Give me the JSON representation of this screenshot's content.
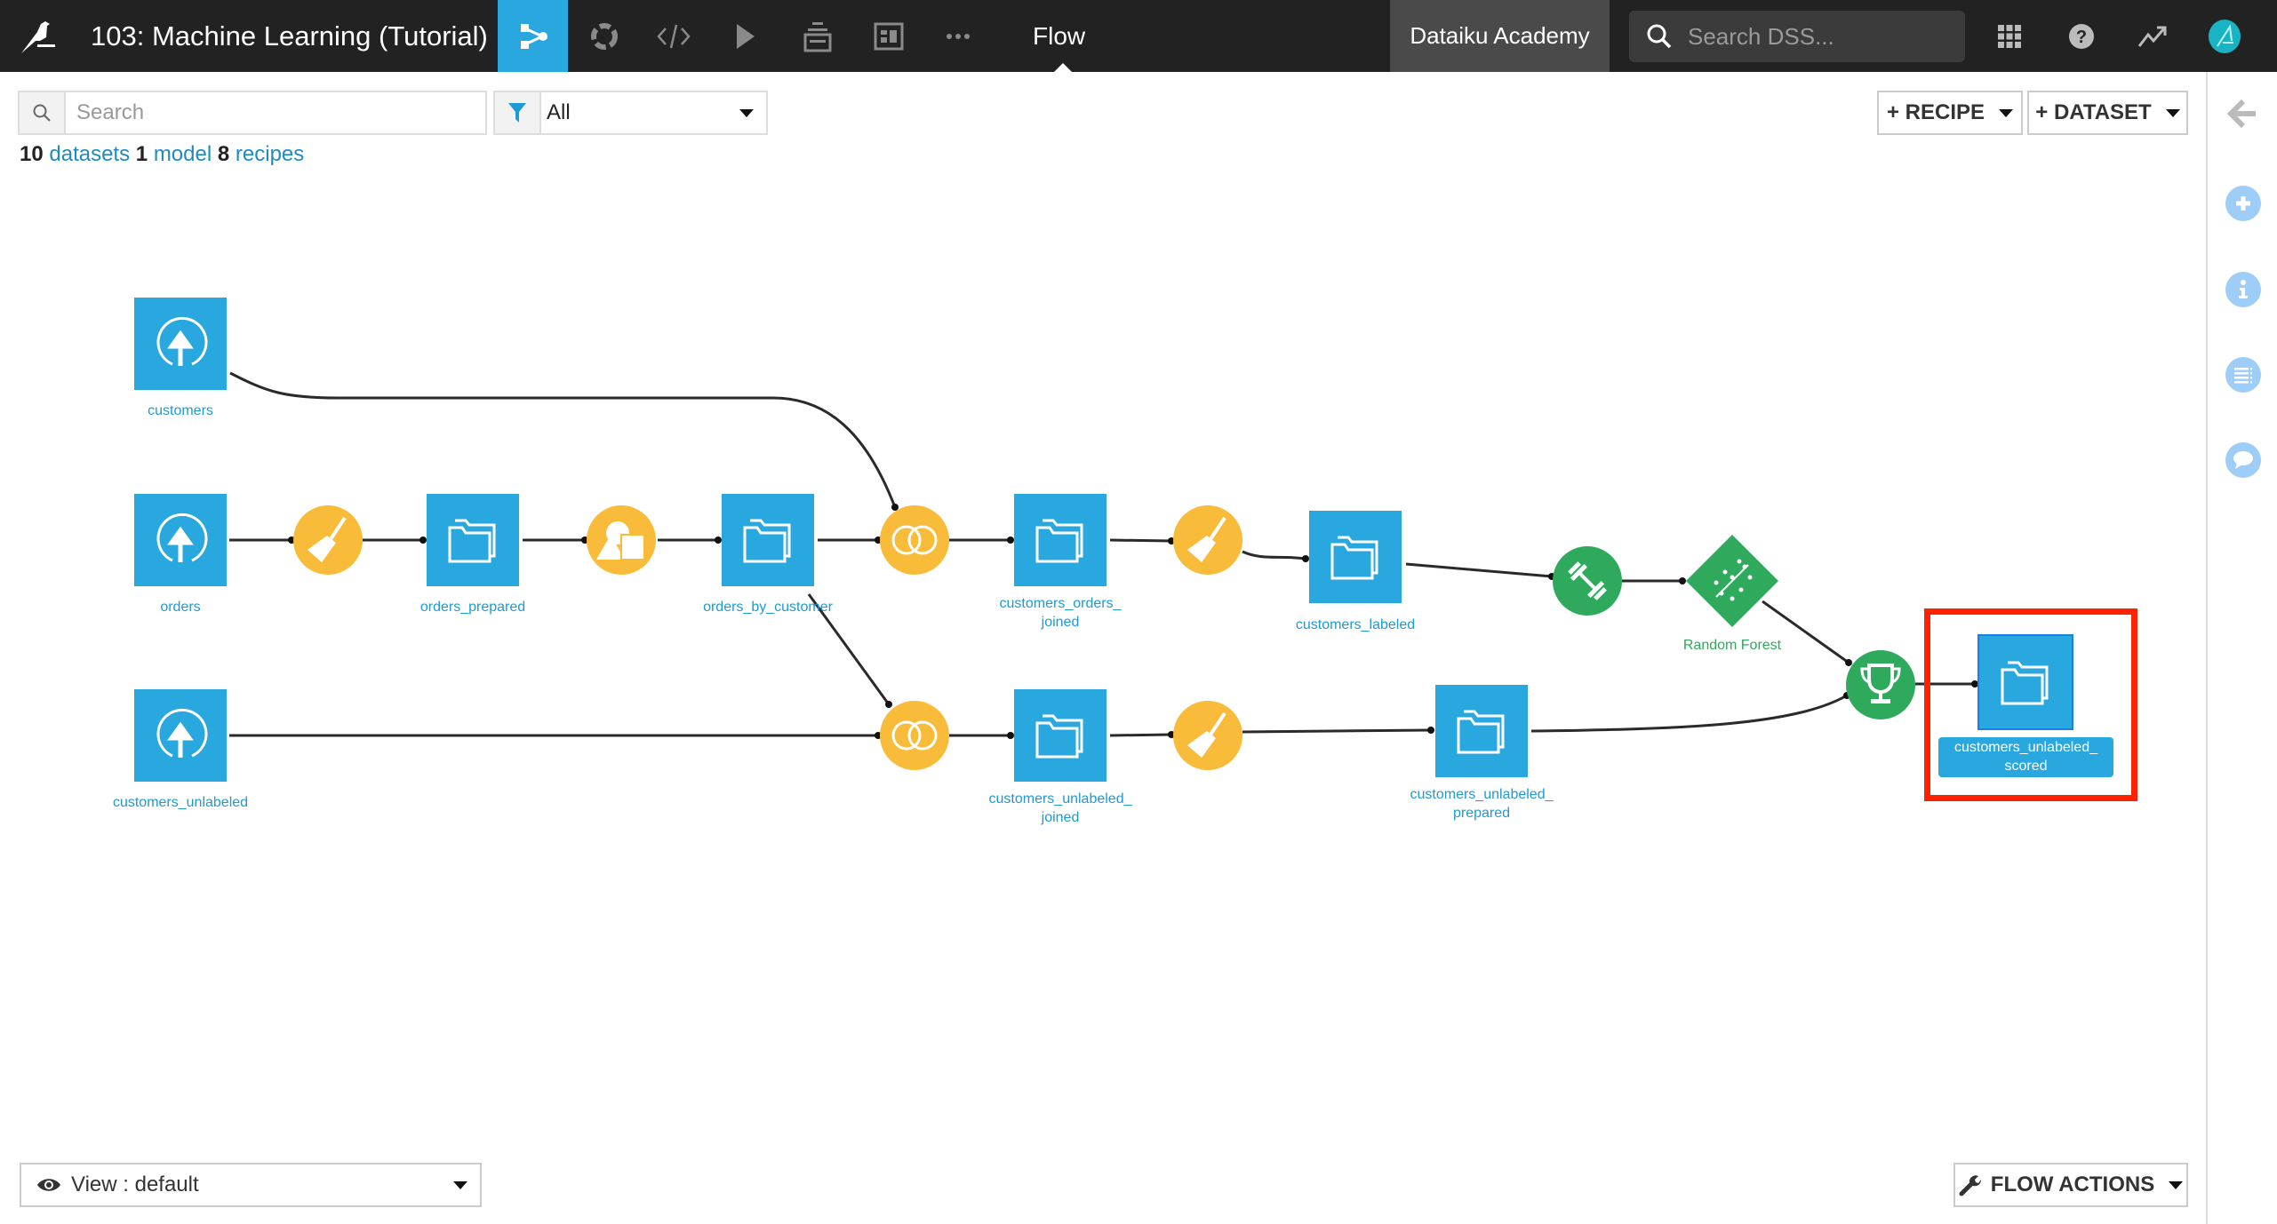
{
  "topbar": {
    "project_title": "103: Machine Learning (Tutorial)",
    "nav_icons": [
      "flow-icon",
      "recipes-circle-icon",
      "code-icon",
      "play-icon",
      "stack-icon",
      "dashboard-icon",
      "more-icon"
    ],
    "current_section": "Flow",
    "instance_name": "Dataiku Academy",
    "search_placeholder": "Search DSS..."
  },
  "toolbar": {
    "search_placeholder": "Search",
    "filter_value": "All",
    "counts": {
      "datasets_count": "10",
      "datasets_label": "datasets",
      "models_count": "1",
      "models_label": "model",
      "recipes_count": "8",
      "recipes_label": "recipes"
    },
    "recipe_button": "+ RECIPE",
    "dataset_button": "+ DATASET"
  },
  "flow": {
    "datasets": [
      {
        "id": "customers",
        "label": "customers",
        "kind": "uploaded"
      },
      {
        "id": "orders",
        "label": "orders",
        "kind": "uploaded"
      },
      {
        "id": "customers_unlabeled",
        "label": "customers_unlabeled",
        "kind": "uploaded"
      },
      {
        "id": "orders_prepared",
        "label": "orders_prepared",
        "kind": "managed"
      },
      {
        "id": "orders_by_customer",
        "label": "orders_by_customer",
        "kind": "managed"
      },
      {
        "id": "customers_orders_joined",
        "label_line1": "customers_orders_",
        "label_line2": "joined",
        "kind": "managed"
      },
      {
        "id": "customers_unlabeled_joined",
        "label_line1": "customers_unlabeled_",
        "label_line2": "joined",
        "kind": "managed"
      },
      {
        "id": "customers_labeled",
        "label": "customers_labeled",
        "kind": "managed"
      },
      {
        "id": "customers_unlabeled_prepared",
        "label_line1": "customers_unlabeled_",
        "label_line2": "prepared",
        "kind": "managed"
      },
      {
        "id": "customers_unlabeled_scored",
        "label_line1": "customers_unlabeled_",
        "label_line2": "scored",
        "kind": "managed",
        "selected": true
      }
    ],
    "recipes": [
      {
        "id": "prepare_orders",
        "type": "prepare"
      },
      {
        "id": "group_orders",
        "type": "group"
      },
      {
        "id": "join_customers_orders",
        "type": "join"
      },
      {
        "id": "join_customers_unlabeled",
        "type": "join"
      },
      {
        "id": "prepare_customers_labeled",
        "type": "prepare"
      },
      {
        "id": "prepare_customers_unlabeled",
        "type": "prepare"
      },
      {
        "id": "train",
        "type": "train"
      },
      {
        "id": "score",
        "type": "score"
      }
    ],
    "model": {
      "label": "Random Forest"
    },
    "colors": {
      "dataset": "#29a8df",
      "visual_recipe": "#f8bb3a",
      "ml": "#2faa5c",
      "highlight": "#ff2200"
    }
  },
  "bottom": {
    "view_label": "View : default",
    "flow_actions": "FLOW ACTIONS"
  },
  "right_sidebar": [
    "back-arrow-icon",
    "plus-icon",
    "info-icon",
    "list-icon",
    "comment-icon"
  ]
}
